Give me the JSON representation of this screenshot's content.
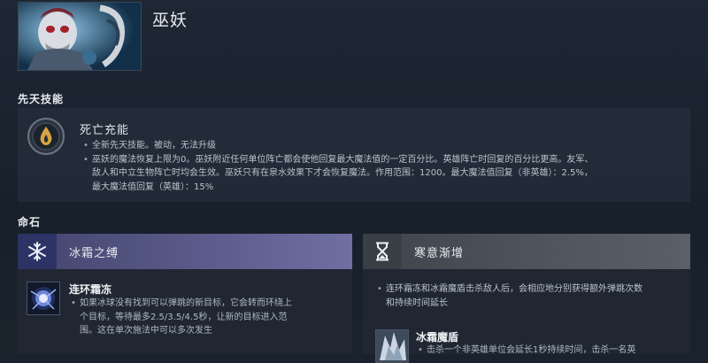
{
  "hero": {
    "name": "巫妖"
  },
  "innate_section": {
    "title": "先天技能",
    "ability_name": "死亡充能",
    "icon": "drop-icon",
    "lines": [
      {
        "bullet": true,
        "text": "全新先天技能。被动，无法升级"
      },
      {
        "bullet": true,
        "text": "巫妖的魔法恢复上限为0。巫妖附近任何单位阵亡都会使他回复最大魔法值的一定百分比。英雄阵亡时回复的百分比更高。友军、"
      },
      {
        "bullet": false,
        "text": "敌人和中立生物阵亡时均会生效。巫妖只有在泉水效果下才会恢复魔法。作用范围：1200。最大魔法值回复（非英雄）：2.5%，"
      },
      {
        "bullet": false,
        "text": "最大魔法值回复（英雄）：15%"
      }
    ]
  },
  "facet_section": {
    "title": "命石",
    "facets": [
      {
        "title": "冰霜之缚",
        "icon": "snowflake-icon",
        "color": "#5a5b8a",
        "ability": {
          "name": "连环霜冻",
          "icon": "frost-orb-icon",
          "lines": [
            "如果冰球没有找到可以弹跳的新目标，它会转而环绕上",
            "个目标，等待最多2.5/3.5/4.5秒，让新的目标进入范",
            "围。这在单次施法中可以多次发生"
          ]
        }
      },
      {
        "title": "寒意渐增",
        "icon": "hourglass-icon",
        "color": "#50565e",
        "description_lines": [
          "连环霜冻和冰霜魔盾击杀敌人后，会相应地分别获得额外弹跳次数",
          "和持续时间延长"
        ],
        "ability": {
          "name": "冰霜魔盾",
          "icon": "frost-shield-icon",
          "lines": [
            "击杀一个非英雄单位会延长1秒持续时间，击杀一名英"
          ]
        }
      }
    ]
  }
}
